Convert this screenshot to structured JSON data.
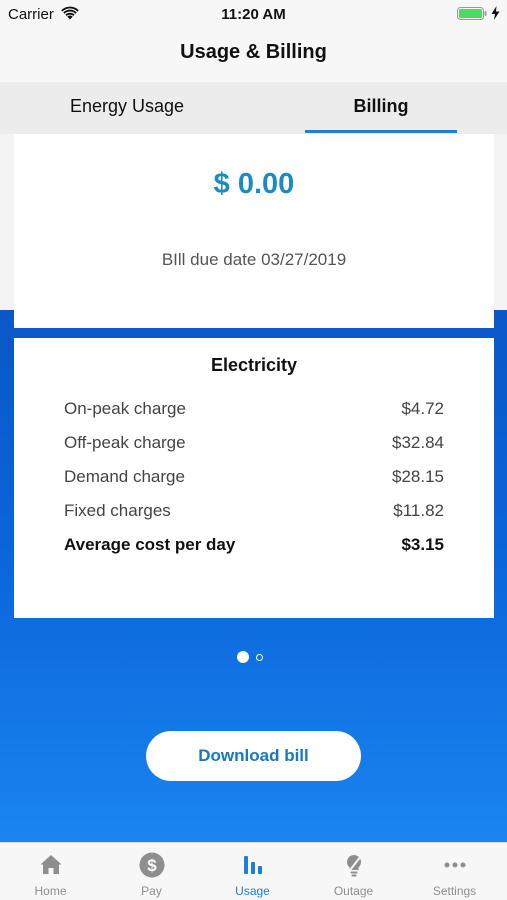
{
  "status_bar": {
    "carrier": "Carrier",
    "time": "11:20 AM",
    "wifi_icon": "wifi-icon",
    "battery_icon": "battery-icon",
    "charging_icon": "charging-bolt-icon",
    "battery_color": "#4cd964"
  },
  "nav": {
    "title": "Usage & Billing"
  },
  "tabs": [
    {
      "label": "Energy Usage",
      "selected": false
    },
    {
      "label": "Billing",
      "selected": true
    }
  ],
  "billing": {
    "amount": "$ 0.00",
    "due_date": "BIll due date 03/27/2019"
  },
  "electricity": {
    "title": "Electricity",
    "rows": [
      {
        "label": "On-peak charge",
        "value": "$4.72",
        "bold": false
      },
      {
        "label": "Off-peak charge",
        "value": "$32.84",
        "bold": false
      },
      {
        "label": "Demand charge",
        "value": "$28.15",
        "bold": false
      },
      {
        "label": "Fixed charges",
        "value": "$11.82",
        "bold": false
      },
      {
        "label": "Average cost per day",
        "value": "$3.15",
        "bold": true
      }
    ]
  },
  "pager": {
    "page_count": 2,
    "current_page": 1
  },
  "download_button": {
    "label": "Download bill"
  },
  "tab_bar": {
    "items": [
      {
        "label": "Home",
        "icon": "home-icon",
        "active": false
      },
      {
        "label": "Pay",
        "icon": "dollar-icon",
        "active": false
      },
      {
        "label": "Usage",
        "icon": "bar-chart-icon",
        "active": true
      },
      {
        "label": "Outage",
        "icon": "lightbulb-icon",
        "active": false
      },
      {
        "label": "Settings",
        "icon": "ellipsis-icon",
        "active": false
      }
    ]
  },
  "colors": {
    "accent": "#1e7fd8",
    "amount": "#1a8bc4",
    "blue_bg_top": "#0a57c8",
    "blue_bg_bottom": "#1a85f0",
    "inactive_tab": "#8e8e8e"
  }
}
